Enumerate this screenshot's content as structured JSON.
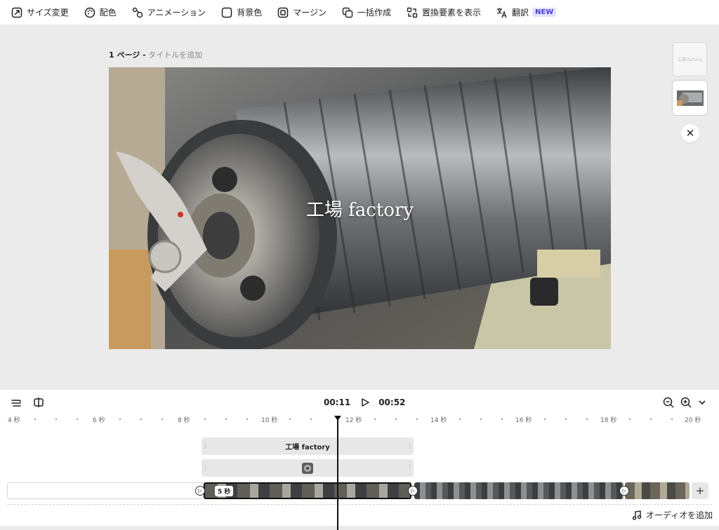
{
  "toolbar": {
    "items": [
      {
        "label": "サイズ変更",
        "icon": "resize-icon"
      },
      {
        "label": "配色",
        "icon": "palette-icon"
      },
      {
        "label": "アニメーション",
        "icon": "animation-icon"
      },
      {
        "label": "背景色",
        "icon": "background-color-icon"
      },
      {
        "label": "マージン",
        "icon": "margin-icon"
      },
      {
        "label": "一括作成",
        "icon": "bulk-create-icon"
      },
      {
        "label": "置換要素を表示",
        "icon": "replace-icon"
      },
      {
        "label": "翻訳",
        "icon": "translate-icon"
      }
    ],
    "new_badge": "NEW"
  },
  "page": {
    "number_label": "1 ページ -",
    "title_placeholder": "タイトルを追加",
    "slide_text": "工場 factory"
  },
  "thumbnails": {
    "first_text": "工場 factory"
  },
  "timeline": {
    "current_time": "00:11",
    "total_time": "00:52",
    "ruler_labels": [
      "4 秒",
      "6 秒",
      "8 秒",
      "10 秒",
      "12 秒",
      "14 秒",
      "16 秒",
      "18 秒",
      "20 秒"
    ],
    "text_track": "工場 factory",
    "clip_duration": "5 秒",
    "add_audio": "オーディオを追加"
  },
  "colors": {
    "accent_new_bg": "#e3e0ff",
    "accent_new_fg": "#4b3fd1",
    "canvas_bg": "#ebebeb"
  }
}
